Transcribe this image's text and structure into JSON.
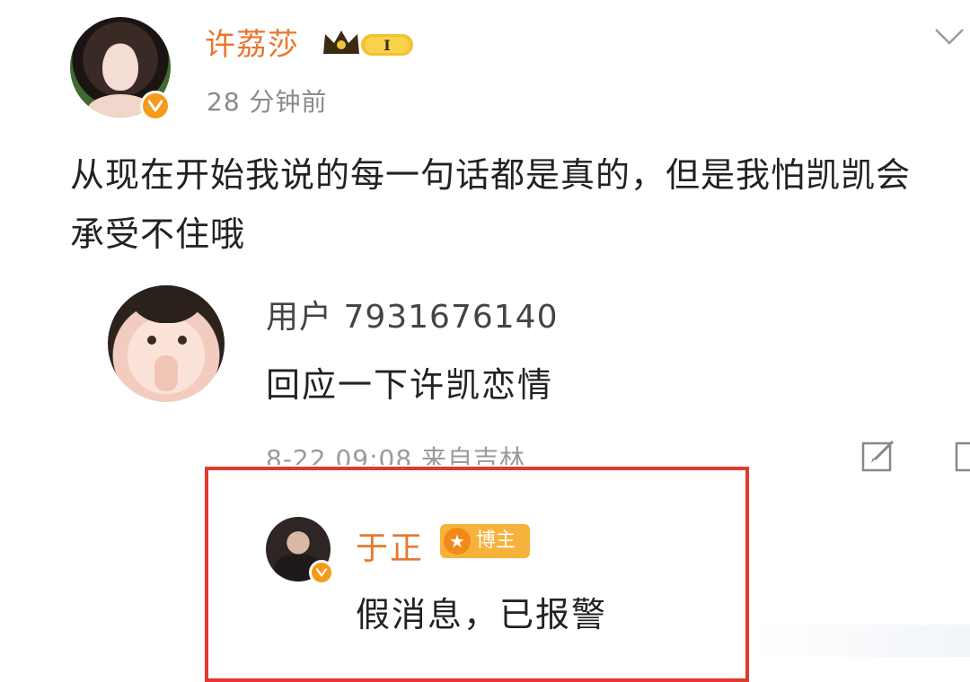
{
  "post": {
    "username": "许荔莎",
    "badge_text": "I",
    "timestamp": "28 分钟前",
    "text": "从现在开始我说的每一句话都是真的，但是我怕凯凯会承受不住哦",
    "icons": {
      "avatar": "user-avatar",
      "verified": "verified-badge-icon",
      "more": "chevron-down-icon"
    }
  },
  "comment": {
    "username": "用户 7931676140",
    "text": "回应一下许凯恋情",
    "meta": "8-22 09:08 来自吉林",
    "icons": {
      "edit": "edit-icon"
    }
  },
  "reply": {
    "username": "于正",
    "badge_label": "博主",
    "text": "假消息，已报警"
  },
  "colors": {
    "username_accent": "#e8772e",
    "highlight_border": "#e23a2e",
    "verified": "#f59a1a",
    "owner_badge": "#f7b23b"
  }
}
